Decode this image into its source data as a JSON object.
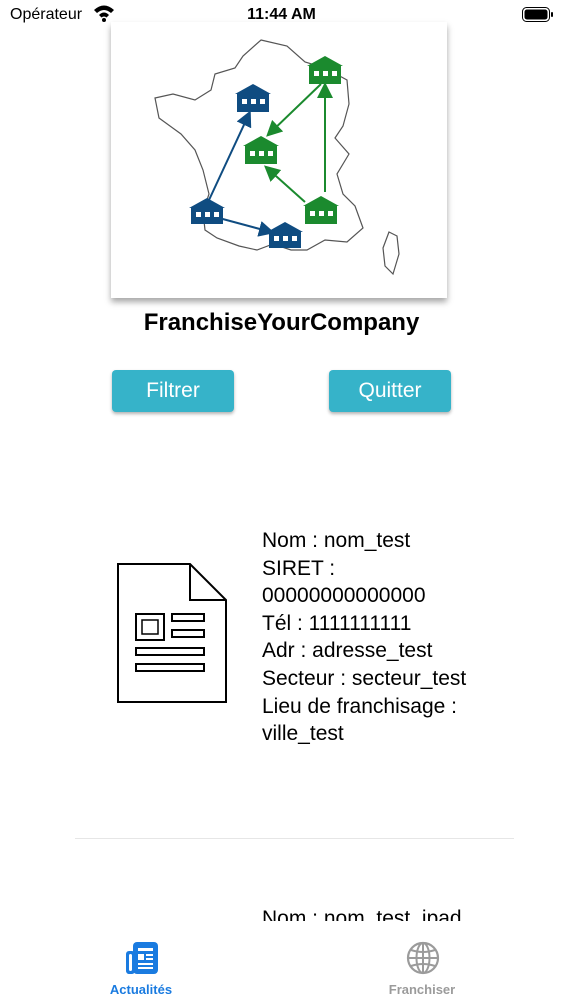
{
  "status_bar": {
    "carrier": "Opérateur",
    "time": "11:44 AM"
  },
  "app": {
    "title": "FranchiseYourCompany"
  },
  "buttons": {
    "filter_label": "Filtrer",
    "quit_label": "Quitter"
  },
  "cards": [
    {
      "lines": [
        "Nom : nom_test",
        "SIRET :",
        "00000000000000",
        "Tél : 1111111111",
        "Adr : adresse_test",
        "Secteur : secteur_test",
        "Lieu de franchisage :",
        "ville_test"
      ]
    },
    {
      "first_line": "Nom : nom_test_ipad"
    }
  ],
  "tabs": [
    {
      "label": "Actualités",
      "icon": "newspaper-icon",
      "active": true
    },
    {
      "label": "Franchiser",
      "icon": "globe-icon",
      "active": false
    }
  ],
  "colors": {
    "button": "#36b3c9",
    "tab_active": "#1a7be0",
    "tab_inactive": "#9b9b9b",
    "map_blue": "#0f4c81",
    "map_green": "#1b8a2e"
  }
}
